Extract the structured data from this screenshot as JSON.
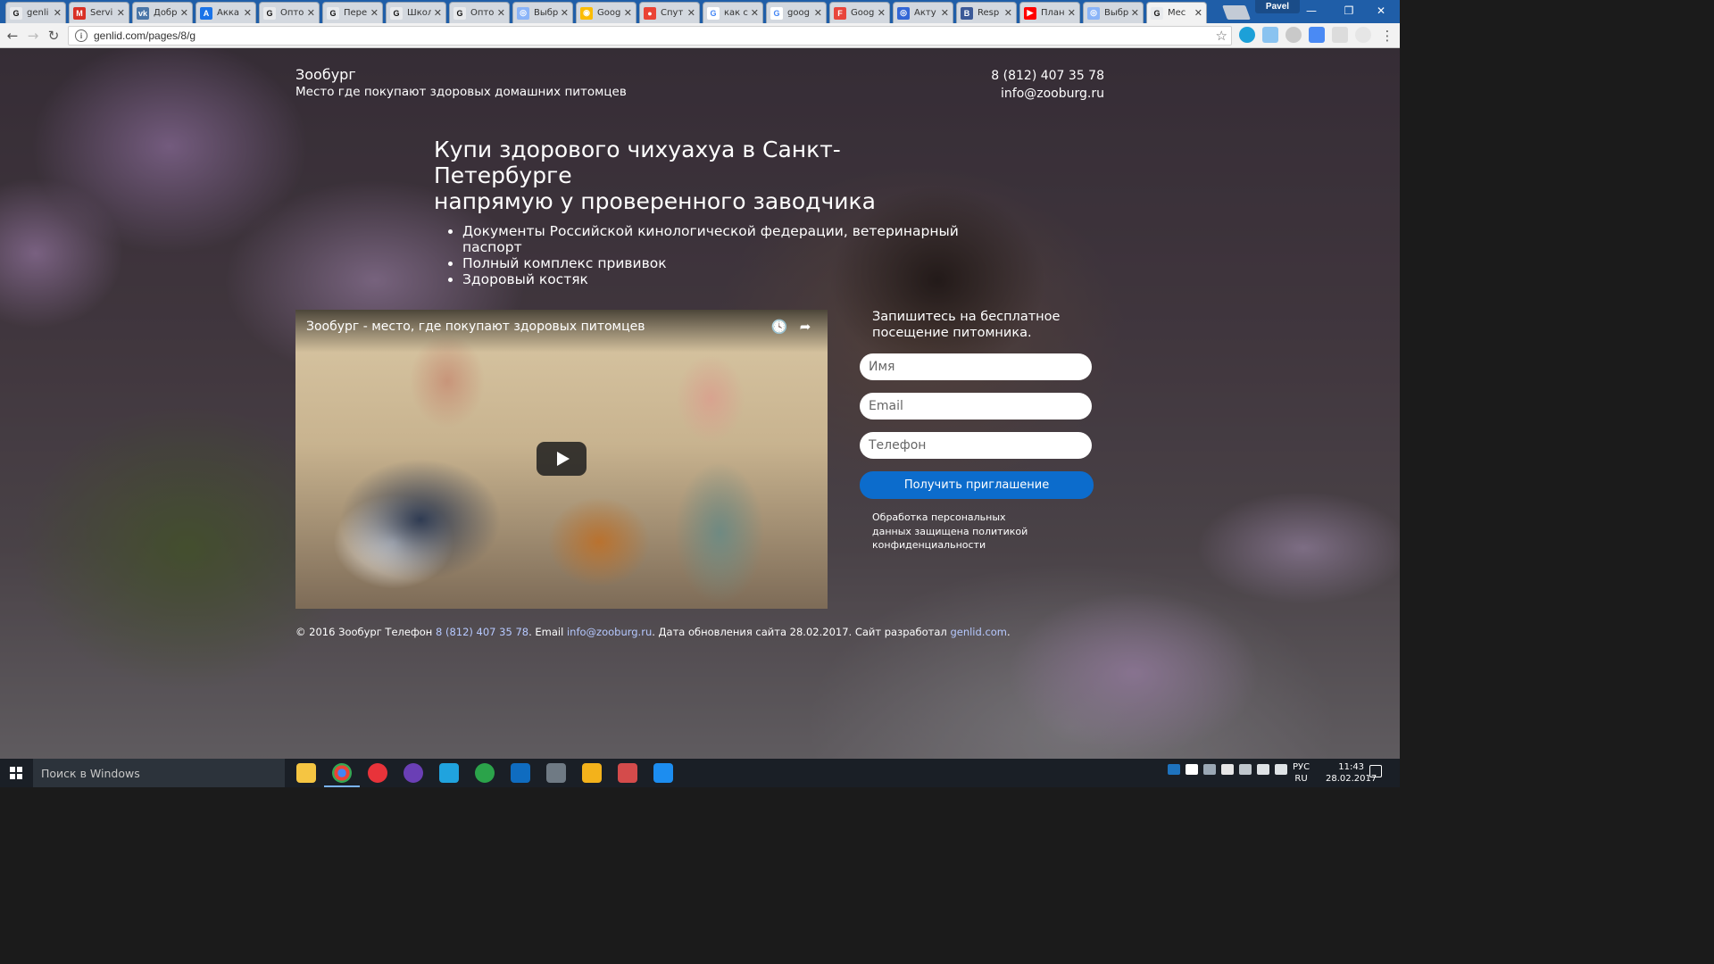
{
  "browser": {
    "tabs": [
      {
        "title": "genli",
        "fav": "G",
        "color": "#e8eaed",
        "fg": "#111"
      },
      {
        "title": "Servi",
        "fav": "M",
        "color": "#d93025",
        "fg": "#fff"
      },
      {
        "title": "Добр",
        "fav": "vk",
        "color": "#4a76a8",
        "fg": "#fff"
      },
      {
        "title": "Акка",
        "fav": "A",
        "color": "#1a73e8",
        "fg": "#fff"
      },
      {
        "title": "Опто",
        "fav": "G",
        "color": "#e8eaed",
        "fg": "#111"
      },
      {
        "title": "Пере",
        "fav": "G",
        "color": "#e8eaed",
        "fg": "#111"
      },
      {
        "title": "Школ",
        "fav": "G",
        "color": "#e8eaed",
        "fg": "#111"
      },
      {
        "title": "Опто",
        "fav": "G",
        "color": "#e8eaed",
        "fg": "#111"
      },
      {
        "title": "Выбр",
        "fav": "◎",
        "color": "#8ab4f8",
        "fg": "#fff"
      },
      {
        "title": "Goog",
        "fav": "◉",
        "color": "#fbbc04",
        "fg": "#fff"
      },
      {
        "title": "Спут",
        "fav": "●",
        "color": "#ea4335",
        "fg": "#fff"
      },
      {
        "title": "как с",
        "fav": "G",
        "color": "#ffffff",
        "fg": "#4285f4"
      },
      {
        "title": "goog",
        "fav": "G",
        "color": "#ffffff",
        "fg": "#4285f4"
      },
      {
        "title": "Goog",
        "fav": "F",
        "color": "#e8453c",
        "fg": "#fff"
      },
      {
        "title": "Акту",
        "fav": "◎",
        "color": "#3367d6",
        "fg": "#fff"
      },
      {
        "title": "Resp",
        "fav": "B",
        "color": "#3b5998",
        "fg": "#fff"
      },
      {
        "title": "План",
        "fav": "▶",
        "color": "#ff0000",
        "fg": "#fff"
      },
      {
        "title": "Выбр",
        "fav": "◎",
        "color": "#8ab4f8",
        "fg": "#fff"
      },
      {
        "title": "Мес",
        "fav": "G",
        "color": "#e8eaed",
        "fg": "#111"
      }
    ],
    "user": "Pavel",
    "url": "genlid.com/pages/8/g"
  },
  "header": {
    "brand": "Зообург",
    "tagline": "Место где покупают здоровых домашних питомцев",
    "phone": "8 (812) 407 35 78",
    "email": "info@zooburg.ru"
  },
  "hero": {
    "title_line1": "Купи здорового чихуахуа в Санкт-Петербурге",
    "title_line2": "напрямую у проверенного заводчика",
    "bullets": [
      "Документы Российской кинологической федерации, ветеринарный паспорт",
      "Полный комплекс прививок",
      "Здоровый костяк"
    ]
  },
  "video": {
    "title": "Зообург - место, где покупают здоровых питомцев",
    "watch_later_icon": "clock-icon",
    "share_icon": "share-icon"
  },
  "form": {
    "title": "Запишитесь на бесплатное посещение питомника.",
    "name_placeholder": "Имя",
    "email_placeholder": "Email",
    "phone_placeholder": "Телефон",
    "submit_label": "Получить приглашение",
    "privacy_text": "Обработка персональных данных защищена политикой конфиденциальности",
    "button_color": "#0c6ccc"
  },
  "footer": {
    "prefix": "© 2016 Зообург Телефон ",
    "phone": "8 (812) 407 35 78",
    "email_prefix": ". Email ",
    "email": "info@zooburg.ru",
    "middle": ". Дата обновления сайта 28.02.2017. Сайт разработал ",
    "dev_link": "genlid.com",
    "suffix": "."
  },
  "taskbar": {
    "search_placeholder": "Поиск в Windows",
    "lang_line1": "РУС",
    "lang_line2": "RU",
    "time": "11:43",
    "date": "28.02.2017"
  }
}
